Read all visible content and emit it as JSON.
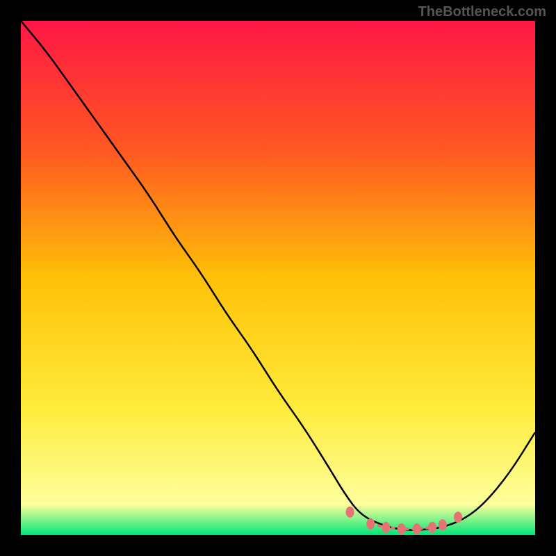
{
  "watermark": "TheBottleneck.com",
  "chart_data": {
    "type": "line",
    "title": "",
    "xlabel": "",
    "ylabel": "",
    "xlim": [
      0,
      100
    ],
    "ylim": [
      0,
      100
    ],
    "grid": false,
    "gradient": {
      "top": "#ff1744",
      "mid_top": "#ff5722",
      "mid": "#ffc107",
      "mid_bottom": "#ffeb3b",
      "bottom_fade": "#feff9c",
      "bottom": "#00e676"
    },
    "curve": {
      "x": [
        0,
        5,
        10,
        15,
        20,
        25,
        30,
        35,
        40,
        45,
        50,
        55,
        60,
        63,
        66,
        70,
        74,
        78,
        82,
        86,
        90,
        95,
        100
      ],
      "y": [
        100,
        94,
        87,
        80,
        73,
        66,
        58,
        51,
        43,
        36,
        28,
        21,
        13,
        8,
        4,
        2,
        1,
        1,
        1.5,
        3,
        6,
        12,
        20
      ]
    },
    "markers": {
      "x": [
        64,
        68,
        71,
        74,
        77,
        80,
        82,
        85
      ],
      "y": [
        4.5,
        2.2,
        1.5,
        1.2,
        1.2,
        1.5,
        2,
        3.5
      ],
      "color": "#e57373"
    }
  }
}
